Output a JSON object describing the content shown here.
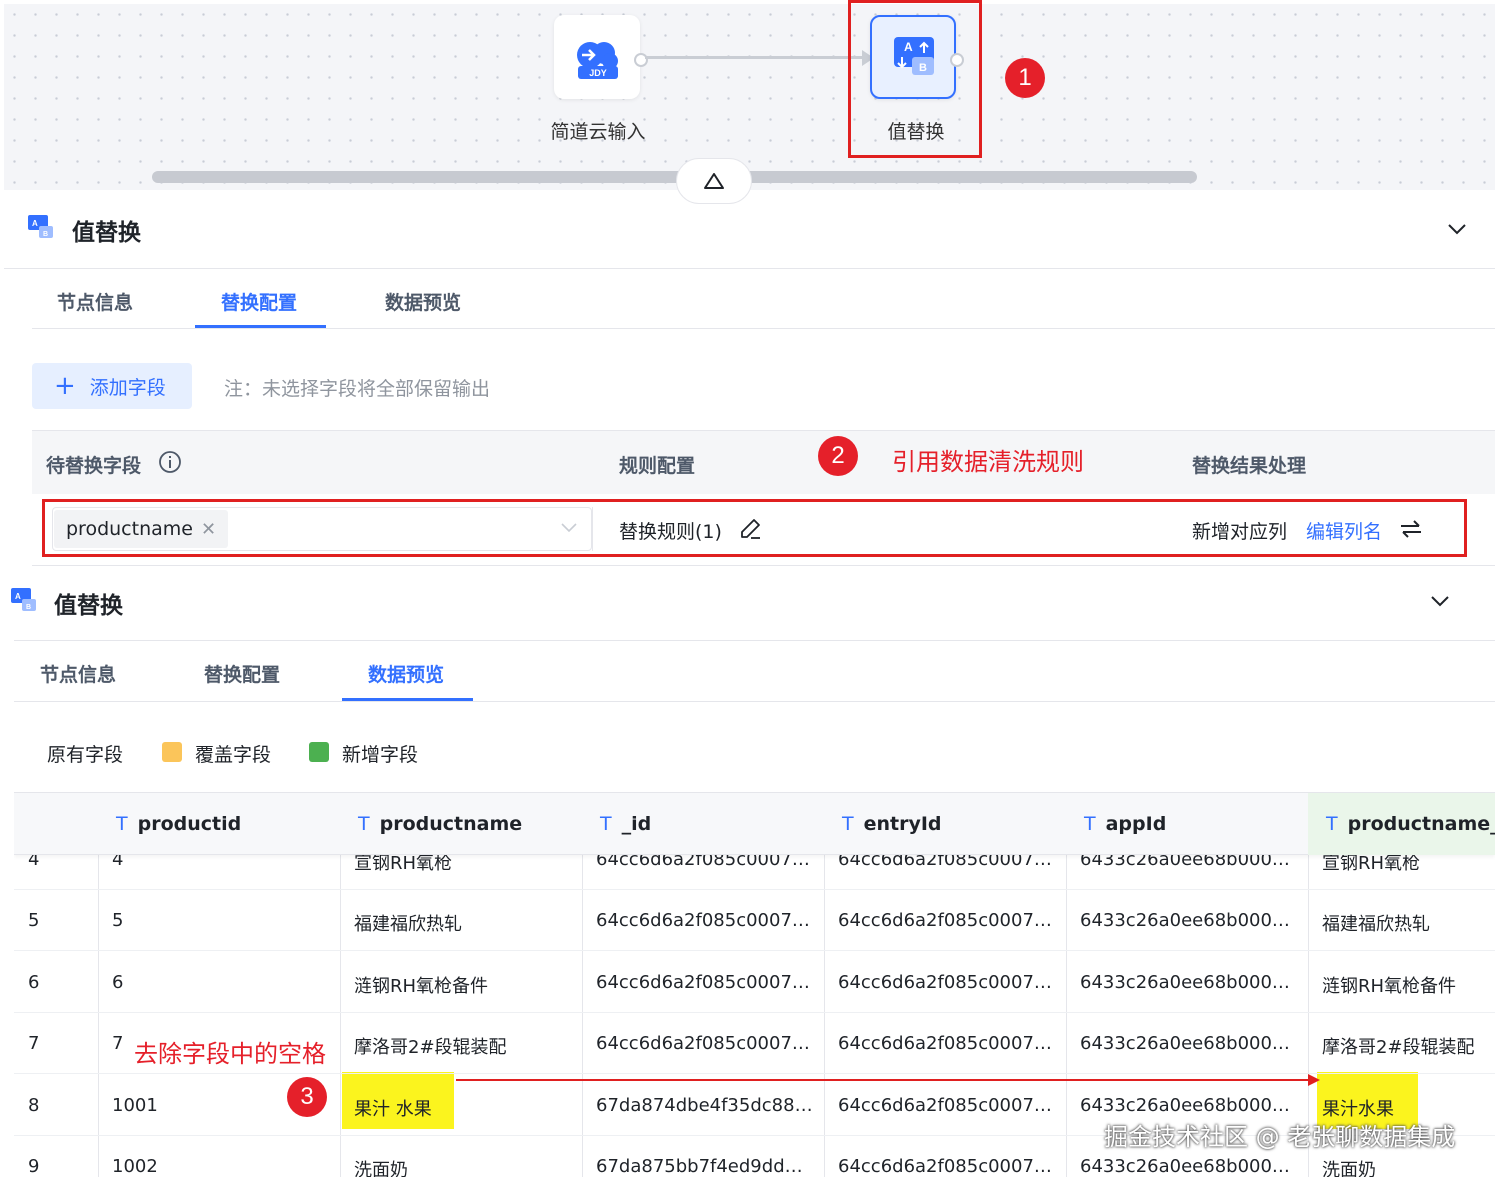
{
  "canvas": {
    "source_node": {
      "label": "简道云输入",
      "icon_text": "JDY",
      "icon": "cloud-input-icon"
    },
    "target_node": {
      "label": "值替换",
      "icon": "replace-ab-icon"
    },
    "collapse_icon": "triangle-up-icon"
  },
  "annotations": {
    "badge1": "1",
    "badge2": "2",
    "badge3": "3",
    "text2": "引用数据清洗规则",
    "text3": "去除字段中的空格",
    "accent_red": "#e5202a",
    "highlight_yellow": "#fbf41e"
  },
  "panel_config": {
    "title": "值替换",
    "tabs": [
      {
        "label": "节点信息",
        "active": false
      },
      {
        "label": "替换配置",
        "active": true
      },
      {
        "label": "数据预览",
        "active": false
      }
    ],
    "add_field_label": "添加字段",
    "note": "注：未选择字段将全部保留输出",
    "headers": {
      "field": "待替换字段",
      "rule": "规则配置",
      "result": "替换结果处理"
    },
    "row": {
      "field_tag": "productname",
      "rule_text": "替换规则(1)",
      "result_text": "新增对应列",
      "edit_col_link": "编辑列名"
    }
  },
  "panel_preview": {
    "title": "值替换",
    "tabs": [
      {
        "label": "节点信息",
        "active": false
      },
      {
        "label": "替换配置",
        "active": false
      },
      {
        "label": "数据预览",
        "active": true
      }
    ],
    "legend": [
      {
        "label": "原有字段",
        "color": ""
      },
      {
        "label": "覆盖字段",
        "color": "#fbc55a"
      },
      {
        "label": "新增字段",
        "color": "#4cb050"
      }
    ],
    "columns": [
      "productid",
      "productname",
      "_id",
      "entryId",
      "appId",
      "productname_"
    ],
    "rows": [
      {
        "n": "4",
        "productid": "4",
        "productname": "宣钢RH氧枪",
        "_id": "64cc6d6a2f085c0007…",
        "entryId": "64cc6d6a2f085c0007…",
        "appId": "6433c26a0ee68b000…",
        "productname_": "宣钢RH氧枪"
      },
      {
        "n": "5",
        "productid": "5",
        "productname": "福建福欣热轧",
        "_id": "64cc6d6a2f085c0007…",
        "entryId": "64cc6d6a2f085c0007…",
        "appId": "6433c26a0ee68b000…",
        "productname_": "福建福欣热轧"
      },
      {
        "n": "6",
        "productid": "6",
        "productname": "涟钢RH氧枪备件",
        "_id": "64cc6d6a2f085c0007…",
        "entryId": "64cc6d6a2f085c0007…",
        "appId": "6433c26a0ee68b000…",
        "productname_": "涟钢RH氧枪备件"
      },
      {
        "n": "7",
        "productid": "7",
        "productname": "摩洛哥2#段辊装配",
        "_id": "64cc6d6a2f085c0007…",
        "entryId": "64cc6d6a2f085c0007…",
        "appId": "6433c26a0ee68b000…",
        "productname_": "摩洛哥2#段辊装配"
      },
      {
        "n": "8",
        "productid": "1001",
        "productname": "果汁 水果",
        "_id": "67da874dbe4f35dc88…",
        "entryId": "64cc6d6a2f085c0007…",
        "appId": "6433c26a0ee68b000…",
        "productname_": "果汁水果"
      },
      {
        "n": "9",
        "productid": "1002",
        "productname": "洗面奶",
        "_id": "67da875bb7f4ed9dd…",
        "entryId": "64cc6d6a2f085c0007…",
        "appId": "6433c26a0ee68b000…",
        "productname_": "洗面奶"
      }
    ]
  },
  "watermark": "掘金技术社区 @ 老张聊数据集成"
}
